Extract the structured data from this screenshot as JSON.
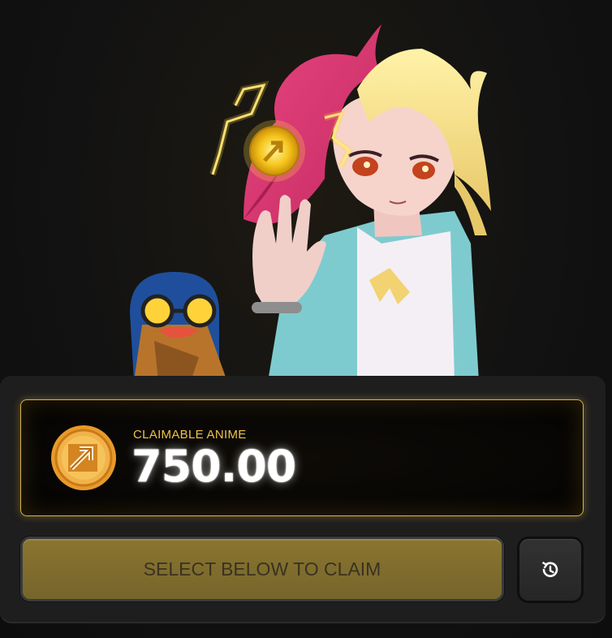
{
  "hero": {
    "illustration": "anime-girl-holding-coin",
    "mascot": "penguin-with-sunglasses",
    "coin_icon": "anime-arrow-coin-icon"
  },
  "claim": {
    "label": "CLAIMABLE ANIME",
    "amount": "750.00",
    "accent_color": "#f0c24a"
  },
  "actions": {
    "select_label": "SELECT BELOW TO CLAIM",
    "history_icon": "history-icon"
  }
}
